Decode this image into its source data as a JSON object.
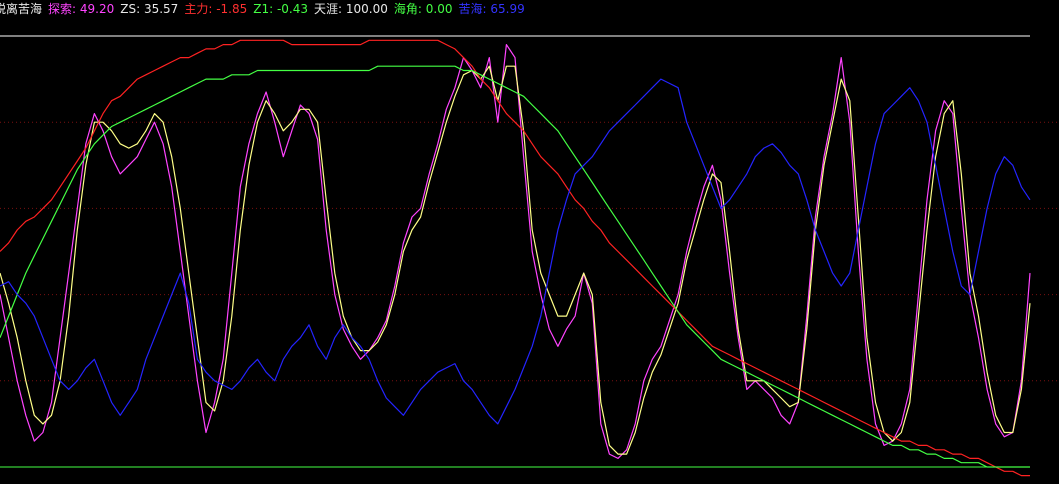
{
  "legend": {
    "title": "脱离苦海",
    "items": [
      {
        "label": "探索",
        "value": "49.20",
        "color": "#ff44ff"
      },
      {
        "label": "ZS",
        "value": "35.57",
        "color": "#e8e8e8"
      },
      {
        "label": "主力",
        "value": "-1.85",
        "color": "#ff3030"
      },
      {
        "label": "Z1",
        "value": "-0.43",
        "color": "#44ff44"
      },
      {
        "label": "天涯",
        "value": "100.00",
        "color": "#e8e8e8"
      },
      {
        "label": "海角",
        "value": "0.00",
        "color": "#44ff44"
      },
      {
        "label": "苦海",
        "value": "65.99",
        "color": "#3333ff"
      }
    ]
  },
  "chart_data": {
    "type": "line",
    "ylim": [
      -3,
      108
    ],
    "xlim": [
      0,
      120
    ],
    "grid_y": [
      80,
      60,
      40,
      20
    ],
    "hlines": [
      {
        "name": "天涯",
        "y": 100,
        "color": "#ffffff"
      },
      {
        "name": "海角",
        "y": 0,
        "color": "#44ff44"
      }
    ],
    "series": [
      {
        "name": "探索",
        "color": "#ff44ff",
        "values": [
          40,
          30,
          20,
          12,
          6,
          8,
          15,
          30,
          45,
          60,
          75,
          82,
          78,
          72,
          68,
          70,
          72,
          76,
          80,
          75,
          65,
          50,
          35,
          20,
          8,
          15,
          25,
          45,
          65,
          75,
          82,
          87,
          80,
          72,
          78,
          84,
          82,
          76,
          55,
          40,
          32,
          28,
          25,
          27,
          30,
          34,
          42,
          52,
          58,
          60,
          68,
          75,
          83,
          88,
          95,
          92,
          88,
          95,
          80,
          98,
          95,
          72,
          50,
          40,
          32,
          28,
          32,
          35,
          45,
          38,
          10,
          3,
          2,
          4,
          10,
          20,
          25,
          28,
          34,
          40,
          50,
          58,
          65,
          70,
          62,
          45,
          30,
          18,
          20,
          18,
          16,
          12,
          10,
          15,
          35,
          58,
          72,
          82,
          95,
          80,
          50,
          25,
          10,
          5,
          6,
          10,
          18,
          40,
          62,
          78,
          85,
          82,
          60,
          40,
          30,
          18,
          10,
          7,
          8,
          20,
          45
        ]
      },
      {
        "name": "ZS",
        "color": "#ffff88",
        "values": [
          45,
          38,
          30,
          20,
          12,
          10,
          12,
          20,
          35,
          55,
          70,
          80,
          80,
          78,
          75,
          74,
          75,
          78,
          82,
          80,
          72,
          60,
          45,
          30,
          15,
          13,
          20,
          35,
          55,
          70,
          80,
          85,
          82,
          78,
          80,
          83,
          83,
          80,
          62,
          45,
          35,
          30,
          27,
          27,
          29,
          33,
          40,
          50,
          55,
          58,
          66,
          73,
          80,
          86,
          91,
          92,
          90,
          93,
          85,
          93,
          93,
          78,
          55,
          45,
          40,
          35,
          35,
          40,
          45,
          40,
          15,
          5,
          3,
          3,
          8,
          16,
          22,
          26,
          32,
          38,
          48,
          55,
          62,
          68,
          66,
          50,
          32,
          20,
          20,
          20,
          18,
          16,
          14,
          15,
          32,
          55,
          70,
          80,
          90,
          85,
          58,
          30,
          15,
          8,
          6,
          8,
          15,
          35,
          55,
          72,
          82,
          85,
          68,
          45,
          35,
          22,
          12,
          8,
          8,
          18,
          38
        ]
      },
      {
        "name": "主力",
        "color": "#ff2222",
        "values": [
          50,
          52,
          55,
          57,
          58,
          60,
          62,
          65,
          68,
          71,
          74,
          78,
          82,
          85,
          86,
          88,
          90,
          91,
          92,
          93,
          94,
          95,
          95,
          96,
          97,
          97,
          98,
          98,
          99,
          99,
          99,
          99,
          99,
          99,
          98,
          98,
          98,
          98,
          98,
          98,
          98,
          98,
          98,
          99,
          99,
          99,
          99,
          99,
          99,
          99,
          99,
          99,
          98,
          97,
          95,
          93,
          90,
          88,
          85,
          82,
          80,
          78,
          75,
          72,
          70,
          68,
          65,
          62,
          60,
          57,
          55,
          52,
          50,
          48,
          46,
          44,
          42,
          40,
          38,
          36,
          34,
          32,
          30,
          28,
          27,
          26,
          25,
          24,
          23,
          22,
          21,
          20,
          19,
          18,
          17,
          16,
          15,
          14,
          13,
          12,
          11,
          10,
          9,
          8,
          7,
          6,
          6,
          5,
          5,
          4,
          4,
          3,
          3,
          2,
          2,
          1,
          0,
          -1,
          -1,
          -2,
          -2
        ]
      },
      {
        "name": "Z1",
        "color": "#44ff44",
        "values": [
          30,
          35,
          40,
          45,
          49,
          53,
          57,
          61,
          65,
          69,
          72,
          75,
          77,
          79,
          80,
          81,
          82,
          83,
          84,
          85,
          86,
          87,
          88,
          89,
          90,
          90,
          90,
          91,
          91,
          91,
          92,
          92,
          92,
          92,
          92,
          92,
          92,
          92,
          92,
          92,
          92,
          92,
          92,
          92,
          93,
          93,
          93,
          93,
          93,
          93,
          93,
          93,
          93,
          93,
          92,
          92,
          91,
          90,
          89,
          88,
          87,
          86,
          84,
          82,
          80,
          78,
          75,
          72,
          69,
          66,
          63,
          60,
          57,
          54,
          51,
          48,
          45,
          42,
          39,
          36,
          33,
          31,
          29,
          27,
          25,
          24,
          23,
          22,
          21,
          20,
          19,
          18,
          17,
          16,
          15,
          14,
          13,
          12,
          11,
          10,
          9,
          8,
          7,
          6,
          5,
          5,
          4,
          4,
          3,
          3,
          2,
          2,
          1,
          1,
          1,
          0,
          0,
          0,
          0,
          0,
          0
        ]
      },
      {
        "name": "苦海",
        "color": "#2424ff",
        "values": [
          42,
          43,
          40,
          38,
          35,
          30,
          25,
          20,
          18,
          20,
          23,
          25,
          20,
          15,
          12,
          15,
          18,
          25,
          30,
          35,
          40,
          45,
          38,
          25,
          22,
          20,
          19,
          18,
          20,
          23,
          25,
          22,
          20,
          25,
          28,
          30,
          33,
          28,
          25,
          30,
          33,
          30,
          28,
          25,
          20,
          16,
          14,
          12,
          15,
          18,
          20,
          22,
          23,
          24,
          20,
          18,
          15,
          12,
          10,
          14,
          18,
          23,
          28,
          35,
          45,
          55,
          62,
          68,
          70,
          72,
          75,
          78,
          80,
          82,
          84,
          86,
          88,
          90,
          89,
          88,
          80,
          75,
          70,
          65,
          60,
          62,
          65,
          68,
          72,
          74,
          75,
          73,
          70,
          68,
          62,
          55,
          50,
          45,
          42,
          45,
          55,
          65,
          75,
          82,
          84,
          86,
          88,
          85,
          80,
          70,
          60,
          50,
          42,
          40,
          50,
          60,
          68,
          72,
          70,
          65,
          62
        ]
      }
    ]
  }
}
